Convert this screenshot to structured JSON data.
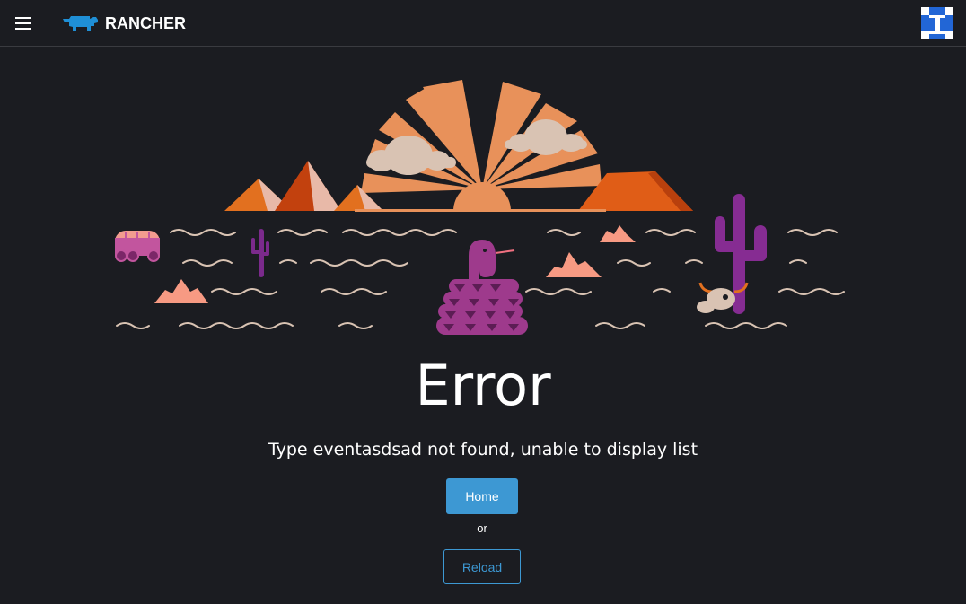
{
  "header": {
    "menu_icon": "hamburger-menu-icon",
    "logo_text": "RANCHER",
    "logo_icon": "rancher-cow-icon",
    "avatar_icon": "user-avatar-icon"
  },
  "illustration": {
    "icon": "desert-error-illustration"
  },
  "error": {
    "title": "Error",
    "message": "Type eventasdsad not found, unable to display list"
  },
  "actions": {
    "home_label": "Home",
    "or_label": "or",
    "reload_label": "Reload"
  },
  "colors": {
    "background": "#1b1c21",
    "accent": "#3d98d3",
    "brand": "#1f8fd6",
    "illustration_orange": "#e8915a",
    "illustration_purple": "#9e3a8c"
  }
}
